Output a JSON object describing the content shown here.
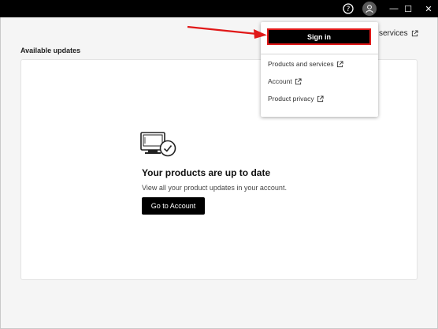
{
  "titlebar": {
    "help_icon": "help-circle-icon",
    "avatar_icon": "user-avatar-icon",
    "minimize_glyph": "—",
    "maximize_glyph": "☐",
    "close_glyph": "✕"
  },
  "header": {
    "services_link": "services"
  },
  "main": {
    "section_title": "Available updates",
    "status_title": "Your products are up to date",
    "status_desc": "View all your product updates in your account.",
    "go_button": "Go to Account"
  },
  "dropdown": {
    "signin": "Sign in",
    "items": [
      {
        "label": "Products and services"
      },
      {
        "label": "Account"
      },
      {
        "label": "Product privacy"
      }
    ]
  },
  "colors": {
    "titlebar": "#000000",
    "accent_button": "#000000",
    "highlight": "#e01818",
    "background": "#f5f5f5"
  }
}
